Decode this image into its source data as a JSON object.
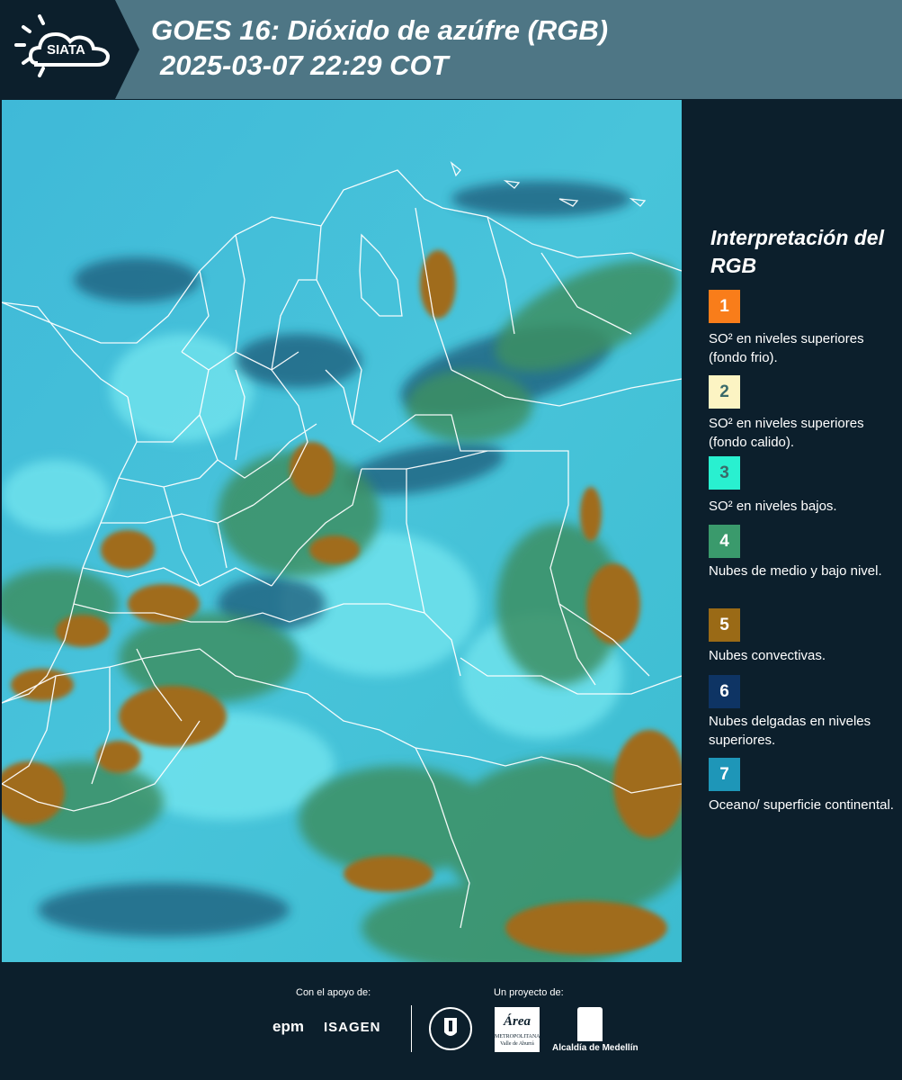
{
  "header": {
    "logo_text": "SIATA",
    "title_line1": "GOES 16: Dióxido de azúfre (RGB)",
    "title_line2": "2025-03-07 22:29 COT"
  },
  "legend": {
    "title": "Interpretación del RGB",
    "items": [
      {
        "number": "1",
        "color": "#f97d1a",
        "text": "SO² en niveles superiores (fondo frio)."
      },
      {
        "number": "2",
        "color": "#fcf4c3",
        "text": "SO² en niveles superiores (fondo calido)."
      },
      {
        "number": "3",
        "color": "#29f0d0",
        "text": "SO² en niveles bajos."
      },
      {
        "number": "4",
        "color": "#3a9a6c",
        "text": "Nubes de medio y bajo nivel."
      },
      {
        "number": "5",
        "color": "#9a6a16",
        "text": "Nubes convectivas."
      },
      {
        "number": "6",
        "color": "#0e3464",
        "text": "Nubes delgadas en niveles superiores."
      },
      {
        "number": "7",
        "color": "#1e96b8",
        "text": "Oceano/ superficie continental."
      }
    ]
  },
  "map": {
    "colors": {
      "background": "#3cc0d8",
      "land_green": "#3e8f6a",
      "convective_brown": "#a0701a",
      "thin_cloud_blue": "#1a5a7a",
      "bright_cyan": "#6de6ee",
      "borders": "#ffffff"
    }
  },
  "footer": {
    "support_label": "Con el apoyo de:",
    "project_label": "Un proyecto de:",
    "epm": "epm",
    "isagen": "ISAGEN",
    "area_name": "Área",
    "area_sub": "METROPOLITANA",
    "area_sub2": "Valle de Aburrá",
    "alcaldia": "Alcaldía de Medellín"
  }
}
